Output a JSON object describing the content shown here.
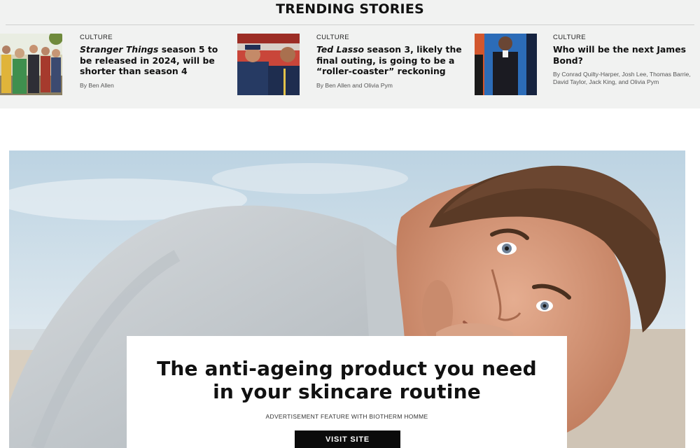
{
  "trending": {
    "title": "TRENDING STORIES",
    "stories": [
      {
        "category": "CULTURE",
        "headline_italic": "Stranger Things",
        "headline_rest": " season 5 to be released in 2024, will be shorter than season 4",
        "byline": "By Ben Allen"
      },
      {
        "category": "CULTURE",
        "headline_italic": "Ted Lasso",
        "headline_rest": " season 3, likely the final outing, is going to be a “roller-coaster” reckoning",
        "byline": "By Ben Allen and Olivia Pym"
      },
      {
        "category": "CULTURE",
        "headline_italic": "",
        "headline_rest": "Who will be the next James Bond?",
        "byline": "By Conrad Quilty-Harper, Josh Lee, Thomas Barrie, David Taylor, Jack King, and Olivia Pym"
      }
    ]
  },
  "promo": {
    "headline_line1": "The anti-ageing product you need",
    "headline_line2": "in your skincare routine",
    "label": "ADVERTISEMENT FEATURE WITH  BIOTHERM HOMME",
    "button": "VISIT SITE"
  },
  "colors": {
    "trending_bg": "#f1f2f1",
    "button_bg": "#0b0b0b",
    "sky": "#c9dbe6",
    "sweater": "#c2c8cc",
    "skin": "#d79a7c",
    "hair": "#5a3a26"
  }
}
